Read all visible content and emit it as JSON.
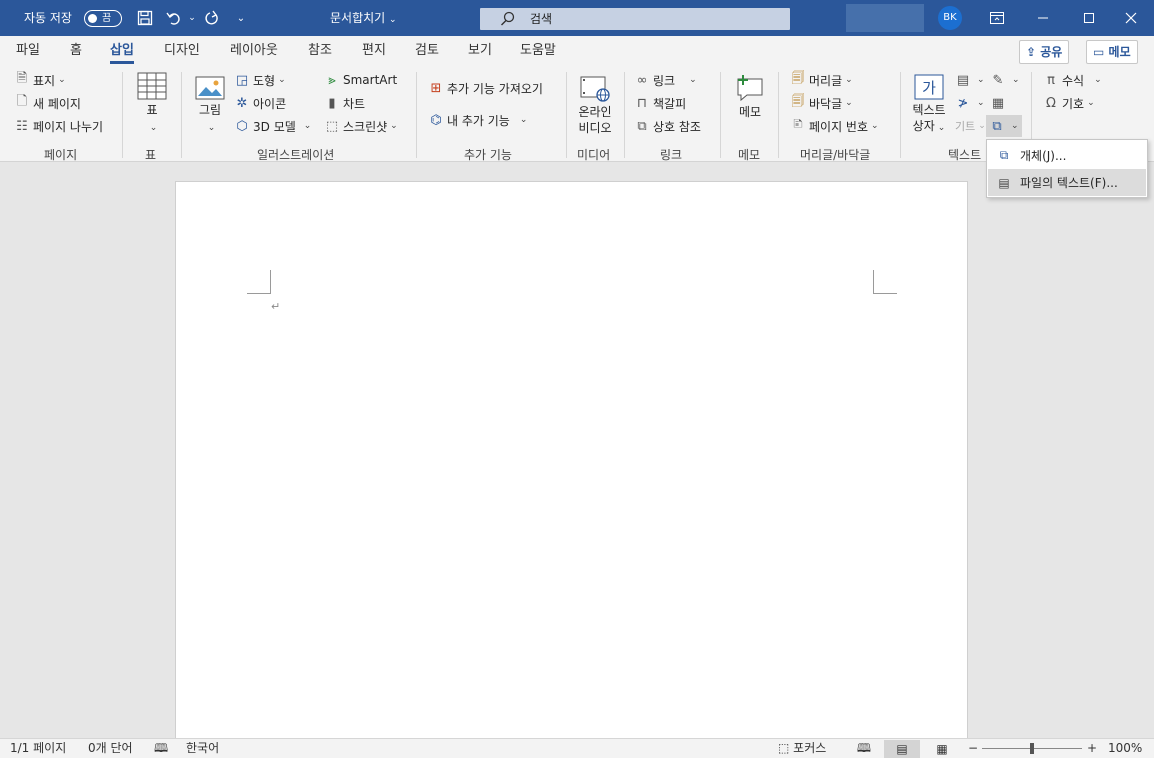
{
  "titlebar": {
    "autosave_label": "자동 저장",
    "autosave_state": "끔",
    "doc_title": "문서합치기",
    "search_placeholder": "검색",
    "user_initials": "BK"
  },
  "tabs": [
    {
      "label": "파일"
    },
    {
      "label": "홈"
    },
    {
      "label": "삽입",
      "active": true
    },
    {
      "label": "디자인"
    },
    {
      "label": "레이아웃"
    },
    {
      "label": "참조"
    },
    {
      "label": "편지"
    },
    {
      "label": "검토"
    },
    {
      "label": "보기"
    },
    {
      "label": "도움말"
    }
  ],
  "share_label": "공유",
  "memo_top_label": "메모",
  "ribbon": {
    "pages": {
      "cover": "표지",
      "blank": "새 페이지",
      "break": "페이지 나누기",
      "group": "페이지"
    },
    "table": {
      "button": "표",
      "group": "표"
    },
    "illustrations": {
      "picture": "그림",
      "shapes": "도형",
      "icons": "아이콘",
      "models3d": "3D 모델",
      "smartart": "SmartArt",
      "chart": "차트",
      "screenshot": "스크린샷",
      "group": "일러스트레이션"
    },
    "addins": {
      "get": "추가 기능 가져오기",
      "my": "내 추가 기능",
      "group": "추가 기능"
    },
    "media": {
      "video_line1": "온라인",
      "video_line2": "비디오",
      "group": "미디어"
    },
    "links": {
      "link": "링크",
      "bookmark": "책갈피",
      "crossref": "상호 참조",
      "group": "링크"
    },
    "comments": {
      "memo": "메모",
      "group": "메모"
    },
    "headerfooter": {
      "header": "머리글",
      "footer": "바닥글",
      "pagenum": "페이지 번호",
      "group": "머리글/바닥글"
    },
    "text": {
      "textbox_line1": "텍스트",
      "textbox_line2": "상자",
      "dropcap": "기트",
      "group": "텍스트"
    },
    "symbols": {
      "equation": "수식",
      "symbol": "기호"
    }
  },
  "dropdown": {
    "items": [
      {
        "label": "개체(J)..."
      },
      {
        "label": "파일의 텍스트(F)...",
        "highlighted": true
      }
    ]
  },
  "statusbar": {
    "page": "1/1 페이지",
    "words": "0개 단어",
    "language": "한국어",
    "focus": "포커스",
    "zoom_minus": "−",
    "zoom_plus": "+",
    "zoom": "100%",
    "zoom_level_percent": 100
  },
  "colors": {
    "accent": "#2b579a",
    "avatar": "#1c6fd1"
  }
}
